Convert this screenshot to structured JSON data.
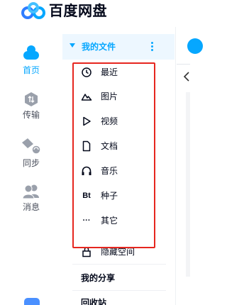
{
  "app": {
    "title": "百度网盘"
  },
  "colors": {
    "accent": "#06a7ff",
    "highlight": "#e6261f",
    "text": "#03081a",
    "muted": "#4a4f5c"
  },
  "nav": {
    "items": [
      {
        "label": "首页",
        "icon": "cloud-icon",
        "active": true
      },
      {
        "label": "传输",
        "icon": "transfer-icon",
        "active": false
      },
      {
        "label": "同步",
        "icon": "sync-icon",
        "active": false
      },
      {
        "label": "消息",
        "icon": "contacts-icon",
        "active": false
      }
    ]
  },
  "panel": {
    "my_files": "我的文件",
    "sub_items": [
      {
        "label": "最近",
        "icon": "clock-icon",
        "glyph": "◷"
      },
      {
        "label": "图片",
        "icon": "mountain-icon",
        "glyph": "⛰"
      },
      {
        "label": "视频",
        "icon": "play-icon",
        "glyph": "▷"
      },
      {
        "label": "文档",
        "icon": "document-icon",
        "glyph": "▯"
      },
      {
        "label": "音乐",
        "icon": "headphones-icon",
        "glyph": "∩"
      },
      {
        "label": "种子",
        "icon": "bt-icon",
        "glyph": "Bt"
      },
      {
        "label": "其它",
        "icon": "ellipsis-icon",
        "glyph": "···"
      },
      {
        "label": "隐藏空间",
        "icon": "lock-icon",
        "glyph": "⊡"
      }
    ],
    "my_share": "我的分享",
    "recycle_bin": "回收站"
  }
}
